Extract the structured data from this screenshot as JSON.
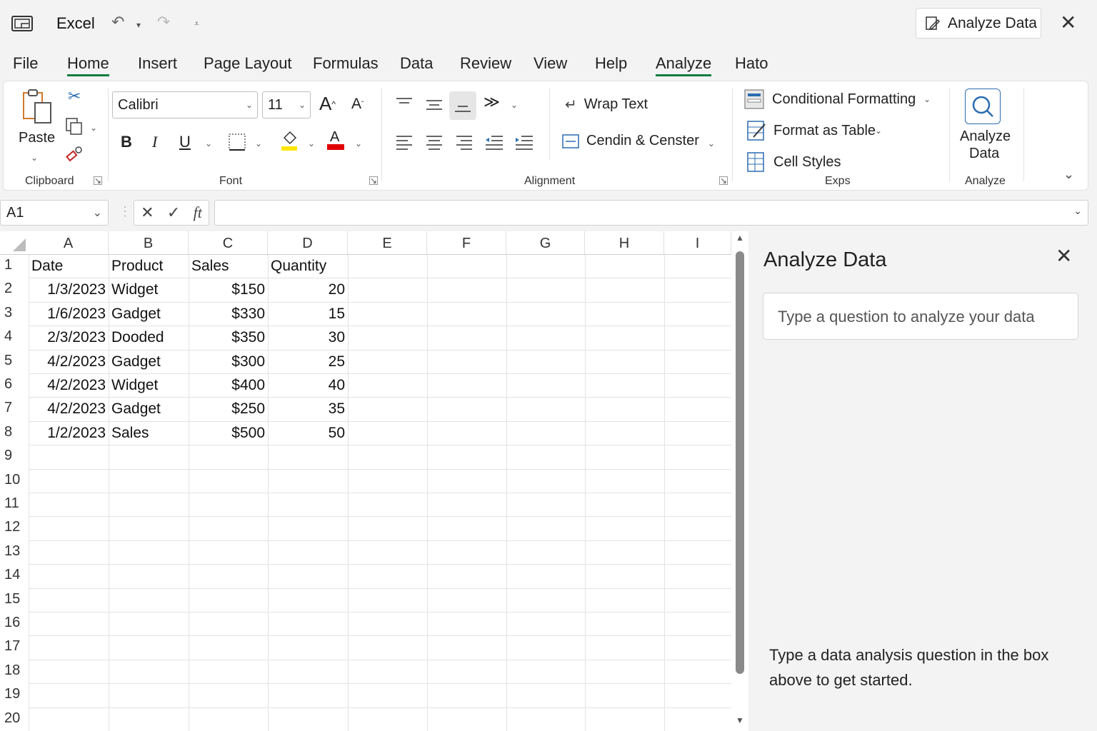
{
  "titlebar": {
    "app_name": "Excel",
    "analyze_button": "Analyze Data"
  },
  "menu_tabs": [
    "File",
    "Home",
    "Insert",
    "Page Layout",
    "Formulas",
    "Data",
    "Review",
    "View",
    "Help",
    "Analyze",
    "Hato"
  ],
  "active_tab": "Home",
  "ribbon": {
    "clipboard": {
      "paste_label": "Paste",
      "group_label": "Clipboard"
    },
    "font": {
      "font_name": "Calibri",
      "font_size": "11",
      "group_label": "Font",
      "highlight_color": "#ffe600",
      "font_color": "#e00000"
    },
    "alignment": {
      "wrap_text": "Wrap Text",
      "merge_center": "Cendin & Censter",
      "group_label": "Alignment"
    },
    "exps": {
      "conditional_formatting": "Conditional Formatting",
      "format_as_table": "Format as Table",
      "cell_styles": "Cell Styles",
      "group_label": "Exps"
    },
    "analyze": {
      "button_label_line1": "Analyze",
      "button_label_line2": "Data",
      "group_label": "Analyze"
    }
  },
  "formula_bar": {
    "name_box": "A1",
    "fx": "ft",
    "value": ""
  },
  "sheet": {
    "columns": [
      "A",
      "B",
      "C",
      "D",
      "E",
      "F",
      "G",
      "H",
      "I"
    ],
    "rows": [
      "1",
      "2",
      "3",
      "4",
      "5",
      "6",
      "7",
      "8",
      "9",
      "10",
      "11",
      "12",
      "13",
      "14",
      "15",
      "16",
      "17",
      "18",
      "19",
      "20"
    ],
    "headers": [
      "Date",
      "Product",
      "Sales",
      "Quantity"
    ],
    "data": [
      [
        "1/3/2023",
        "Widget",
        "$150",
        "20"
      ],
      [
        "1/6/2023",
        "Gadget",
        "$330",
        "15"
      ],
      [
        "2/3/2023",
        "Dooded",
        "$350",
        "30"
      ],
      [
        "4/2/2023",
        "Gadget",
        "$300",
        "25"
      ],
      [
        "4/2/2023",
        "Widget",
        "$400",
        "40"
      ],
      [
        "4/2/2023",
        "Gadget",
        "$250",
        "35"
      ],
      [
        "1/2/2023",
        "Sales",
        "$500",
        "50"
      ]
    ]
  },
  "analyze_pane": {
    "title": "Analyze Data",
    "input_placeholder": "Type a question to analyze your data",
    "help_text": "Type a data analysis question in the box above to get started."
  },
  "colors": {
    "accent": "#107c41"
  }
}
